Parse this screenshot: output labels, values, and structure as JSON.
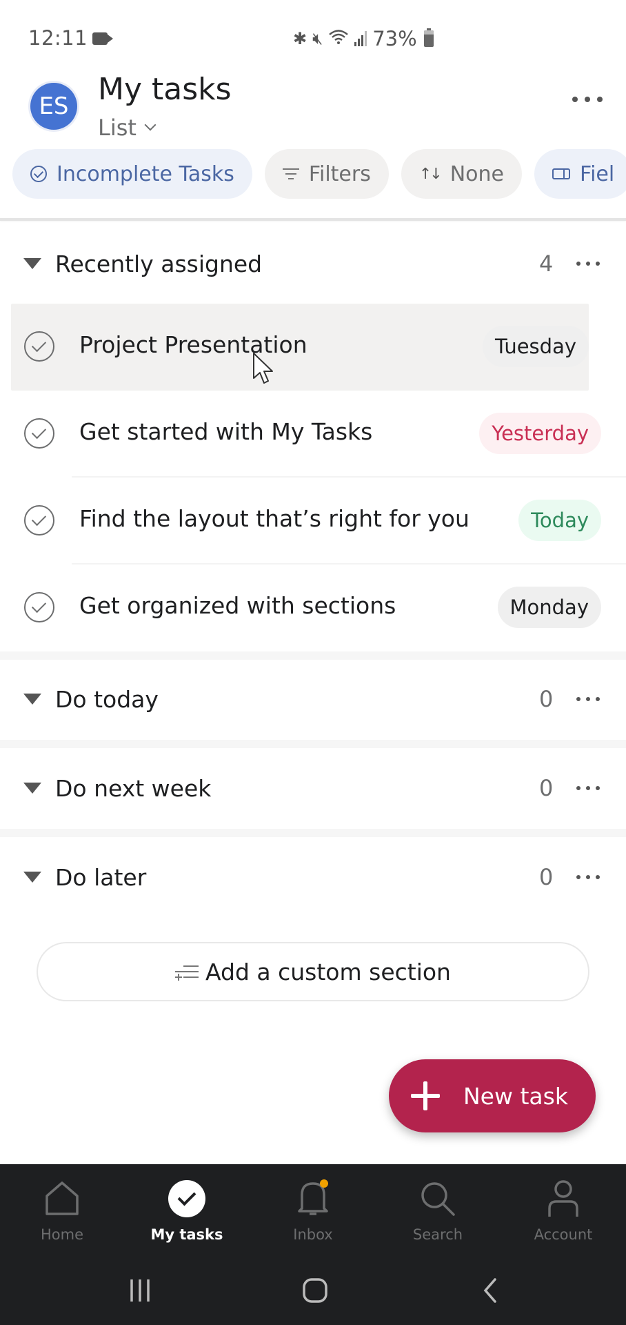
{
  "status_bar": {
    "time": "12:11",
    "battery_percent": "73%",
    "icons": [
      "video-recording-icon",
      "bluetooth-icon",
      "mute-vibrate-icon",
      "wifi-icon",
      "signal-icon",
      "battery-icon"
    ]
  },
  "header": {
    "avatar_initials": "ES",
    "avatar_color": "#4573d2",
    "title": "My tasks",
    "view_label": "List",
    "more_icon": "more-horizontal-icon"
  },
  "chips": [
    {
      "label": "Incomplete Tasks",
      "icon": "check-circle-icon",
      "style": "blue"
    },
    {
      "label": "Filters",
      "icon": "filter-icon",
      "style": "gray"
    },
    {
      "label": "None",
      "icon": "sort-icon",
      "style": "gray"
    },
    {
      "label": "Fiel",
      "icon": "fields-icon",
      "style": "blue"
    }
  ],
  "sections": [
    {
      "title": "Recently assigned",
      "count": "4",
      "tasks": [
        {
          "name": "Project Presentation",
          "due": "Tuesday",
          "due_style": "neutral"
        },
        {
          "name": "Get started with My Tasks",
          "due": "Yesterday",
          "due_style": "overdue"
        },
        {
          "name": "Find the layout that’s right for you",
          "due": "Today",
          "due_style": "today"
        },
        {
          "name": "Get organized with sections",
          "due": "Monday",
          "due_style": "neutral"
        }
      ]
    },
    {
      "title": "Do today",
      "count": "0",
      "tasks": []
    },
    {
      "title": "Do next week",
      "count": "0",
      "tasks": []
    },
    {
      "title": "Do later",
      "count": "0",
      "tasks": []
    }
  ],
  "add_section_label": "Add a custom section",
  "fab": {
    "label": "New task",
    "color": "#b3234d"
  },
  "bottom_nav": [
    {
      "label": "Home",
      "icon": "home-icon",
      "active": false
    },
    {
      "label": "My tasks",
      "icon": "check-circle-icon",
      "active": true
    },
    {
      "label": "Inbox",
      "icon": "bell-icon",
      "active": false,
      "badge": true
    },
    {
      "label": "Search",
      "icon": "search-icon",
      "active": false
    },
    {
      "label": "Account",
      "icon": "account-icon",
      "active": false
    }
  ],
  "colors": {
    "overdue_text": "#c92f54",
    "today_text": "#2e8a5c",
    "chip_blue_text": "#4b67a3",
    "nav_background": "#1e1f21",
    "inbox_badge": "#f1a100"
  }
}
